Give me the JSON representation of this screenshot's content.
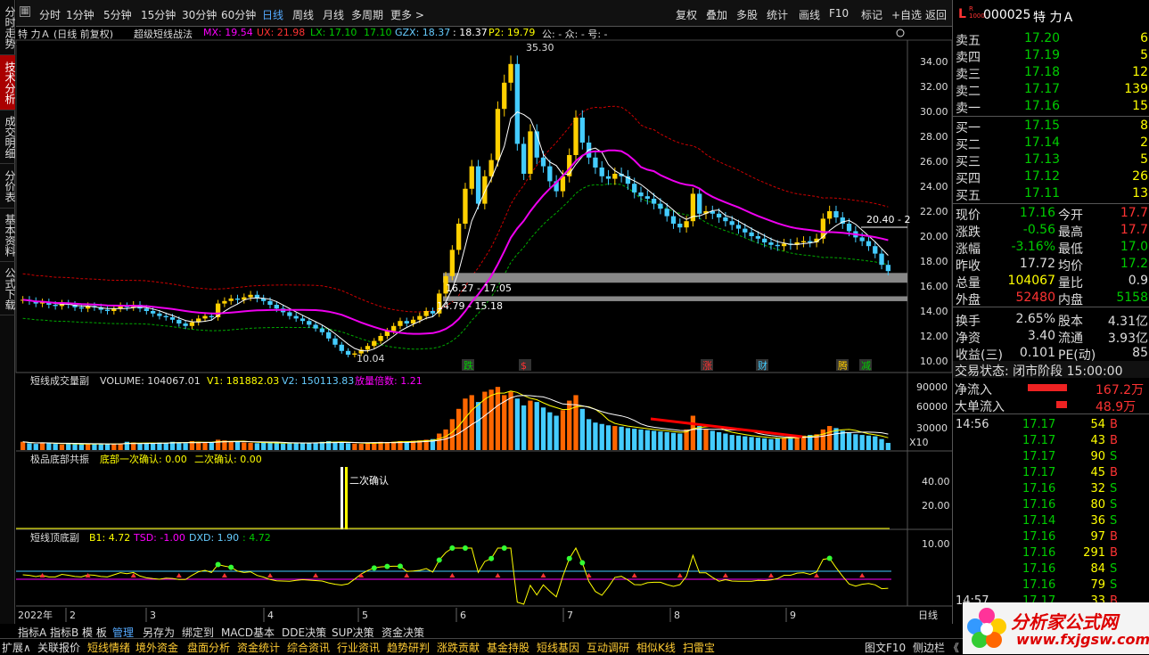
{
  "vtabs": [
    "分时走势",
    "技术分析",
    "成交明细",
    "分价表",
    "基本资料",
    "公式下载"
  ],
  "toolbar": {
    "periods": [
      "分时",
      "1分钟",
      "5分钟",
      "15分钟",
      "30分钟",
      "60分钟",
      "日线",
      "周线",
      "月线",
      "多周期",
      "更多 >"
    ],
    "right_buttons": [
      "复权",
      "叠加",
      "多股",
      "统计",
      "画线",
      "F10",
      "标记",
      "+自选",
      "返回"
    ]
  },
  "title": {
    "stock": "特 力Ａ (日线 前复权)",
    "indicator": "超级短线战法",
    "items": [
      "MX: 19.54",
      "UX: 21.98",
      "LX: 17.10",
      "17.10",
      "GZX: 18.37",
      ": 18.37",
      "P2: 19.79",
      "公: -  众: -  号: -"
    ]
  },
  "main_axis": [
    "34.00",
    "32.00",
    "30.00",
    "28.00",
    "26.00",
    "24.00",
    "22.00",
    "20.00",
    "18.00",
    "16.00",
    "14.00",
    "12.00",
    "10.00"
  ],
  "annotations": {
    "high": "35.30",
    "low": "10.04",
    "zone1": "16.27 - 17.05",
    "zone2": "14.79 - 15.18",
    "right_tag": "20.40 - 2"
  },
  "signals": [
    "跌",
    "$",
    "涨",
    "财",
    "腾",
    "减"
  ],
  "volume_panel": {
    "title": "短线成交量副",
    "volume": "VOLUME: 104067.01",
    "v1": "V1: 181882.03",
    "v2": "V2: 150113.83",
    "ratio": "放量倍数: 1.21",
    "axis": [
      "90000",
      "60000",
      "30000"
    ],
    "unit": "X10"
  },
  "bottom_panel": {
    "title": "极品底部共振",
    "first": "底部一次确认: 0.00",
    "second": "二次确认: 0.00",
    "axis": [
      "40.00",
      "20.00"
    ],
    "label": "二次确认"
  },
  "top_panel": {
    "title": "短线顶底副",
    "b1": "B1: 4.72",
    "tsd": "TSD: -1.00",
    "dxd": "DXD: 1.90",
    "last": ": 4.72",
    "axis": [
      "10.00"
    ]
  },
  "x_axis": {
    "year": "2022年",
    "months": [
      "2",
      "3",
      "4",
      "5",
      "6",
      "7",
      "8",
      "9"
    ],
    "period": "日线"
  },
  "tabs_bottom": [
    "指标A",
    "指标B",
    "模 板",
    "管理",
    "另存为",
    "绑定到",
    "MACD基本",
    "DDE决策",
    "SUP决策",
    "资金决策"
  ],
  "bottom_menu": [
    "扩展∧",
    "关联报价",
    "短线情绪",
    "境外资金",
    "盘面分析",
    "资金统计",
    "综合资讯",
    "行业资讯",
    "趋势研判",
    "涨跌贡献",
    "基金持股",
    "短线基因",
    "互动调研",
    "相似K线",
    "扫雷宝",
    "图文F10",
    "侧边栏 《"
  ],
  "quote": {
    "code": "000025",
    "name": "特 力Ａ",
    "asks": [
      {
        "label": "卖五",
        "price": "17.20",
        "vol": "6"
      },
      {
        "label": "卖四",
        "price": "17.19",
        "vol": "5"
      },
      {
        "label": "卖三",
        "price": "17.18",
        "vol": "12"
      },
      {
        "label": "卖二",
        "price": "17.17",
        "vol": "139"
      },
      {
        "label": "卖一",
        "price": "17.16",
        "vol": "15"
      }
    ],
    "bids": [
      {
        "label": "买一",
        "price": "17.15",
        "vol": "8"
      },
      {
        "label": "买二",
        "price": "17.14",
        "vol": "2"
      },
      {
        "label": "买三",
        "price": "17.13",
        "vol": "5"
      },
      {
        "label": "买四",
        "price": "17.12",
        "vol": "26"
      },
      {
        "label": "买五",
        "price": "17.11",
        "vol": "13"
      }
    ],
    "stats": [
      {
        "l1": "现价",
        "v1": "17.16",
        "l2": "今开",
        "v2": "17.7"
      },
      {
        "l1": "涨跌",
        "v1": "-0.56",
        "l2": "最高",
        "v2": "17.7"
      },
      {
        "l1": "涨幅",
        "v1": "-3.16%",
        "l2": "最低",
        "v2": "17.0"
      },
      {
        "l1": "昨收",
        "v1": "17.72",
        "l2": "均价",
        "v2": "17.2"
      },
      {
        "l1": "总量",
        "v1": "104067",
        "l2": "量比",
        "v2": "0.9"
      },
      {
        "l1": "外盘",
        "v1": "52480",
        "l2": "内盘",
        "v2": "5158"
      },
      {
        "l1": "换手",
        "v1": "2.65%",
        "l2": "股本",
        "v2": "4.31亿"
      },
      {
        "l1": "净资",
        "v1": "3.40",
        "l2": "流通",
        "v2": "3.93亿"
      },
      {
        "l1": "收益(三)",
        "v1": "0.101",
        "l2": "PE(动)",
        "v2": "85"
      }
    ],
    "trade_status": "交易状态: 闭市阶段 15:00:00",
    "net_inflow": {
      "label": "净流入",
      "value": "167.2万"
    },
    "big_inflow": {
      "label": "大单流入",
      "value": "48.9万"
    },
    "ticks": [
      {
        "time": "14:56",
        "price": "17.17",
        "vol": "54",
        "side": "B"
      },
      {
        "time": "",
        "price": "17.17",
        "vol": "43",
        "side": "B"
      },
      {
        "time": "",
        "price": "17.17",
        "vol": "90",
        "side": "S"
      },
      {
        "time": "",
        "price": "17.17",
        "vol": "45",
        "side": "B"
      },
      {
        "time": "",
        "price": "17.16",
        "vol": "32",
        "side": "S"
      },
      {
        "time": "",
        "price": "17.16",
        "vol": "80",
        "side": "S"
      },
      {
        "time": "",
        "price": "17.14",
        "vol": "36",
        "side": "S"
      },
      {
        "time": "",
        "price": "17.16",
        "vol": "97",
        "side": "B"
      },
      {
        "time": "",
        "price": "17.16",
        "vol": "291",
        "side": "B"
      },
      {
        "time": "",
        "price": "17.16",
        "vol": "84",
        "side": "S"
      },
      {
        "time": "",
        "price": "17.16",
        "vol": "79",
        "side": "S"
      },
      {
        "time": "14:57",
        "price": "17.17",
        "vol": "33",
        "side": "B"
      }
    ]
  },
  "logo": {
    "text": "分析家公式网",
    "url": "www.fxjgsw.com"
  },
  "chart_data": {
    "type": "candlestick",
    "price_range": [
      10,
      35.5
    ],
    "closes": [
      14.9,
      14.8,
      14.6,
      14.7,
      14.5,
      14.4,
      14.6,
      14.5,
      14.3,
      14.2,
      14.4,
      14.3,
      14.1,
      14.0,
      14.2,
      14.4,
      14.3,
      14.5,
      14.2,
      14.0,
      13.8,
      13.6,
      13.5,
      13.3,
      13.0,
      12.8,
      13.1,
      13.4,
      13.6,
      13.5,
      14.6,
      14.8,
      15.0,
      14.9,
      15.1,
      15.3,
      15.0,
      14.8,
      14.5,
      14.2,
      13.9,
      13.6,
      13.4,
      13.2,
      12.9,
      12.6,
      12.3,
      11.8,
      11.3,
      10.8,
      10.5,
      10.6,
      10.9,
      11.2,
      11.6,
      12.0,
      12.4,
      12.8,
      13.2,
      13.0,
      13.3,
      13.6,
      14.0,
      13.8,
      15.4,
      16.8,
      18.9,
      21.0,
      23.8,
      25.6,
      22.6,
      24.8,
      26.1,
      30.2,
      32.3,
      33.8,
      27.4,
      25.0,
      28.4,
      26.3,
      25.6,
      24.4,
      23.6,
      24.8,
      26.5,
      29.5,
      27.5,
      26.3,
      25.5,
      24.8,
      24.6,
      25.0,
      24.8,
      24.2,
      23.5,
      23.2,
      23.0,
      22.6,
      22.2,
      21.6,
      21.0,
      20.7,
      21.2,
      23.4,
      21.8,
      22.0,
      21.8,
      21.5,
      21.2,
      20.9,
      20.6,
      20.3,
      20.0,
      19.8,
      19.5,
      19.3,
      19.2,
      19.4,
      19.3,
      19.5,
      19.6,
      19.5,
      19.8,
      21.4,
      22.0,
      21.5,
      21.0,
      20.4,
      19.9,
      19.6,
      19.2,
      18.6,
      17.7,
      17.2
    ],
    "ma_main": {
      "name": "MX",
      "last": 19.54
    },
    "upper": {
      "name": "UX",
      "last": 21.98
    },
    "lower": {
      "name": "LX",
      "last": 17.1
    },
    "volume_range": [
      0,
      100000
    ],
    "volumes": [
      12000,
      10000,
      9000,
      11000,
      10000,
      9000,
      8000,
      9500,
      9000,
      8800,
      9000,
      8500,
      8800,
      9200,
      9000,
      9500,
      12000,
      11000,
      9000,
      9500,
      10000,
      11000,
      10500,
      12000,
      11000,
      10000,
      13000,
      12000,
      11000,
      10500,
      15000,
      14000,
      13000,
      12000,
      11000,
      10500,
      10000,
      11000,
      10500,
      10000,
      9500,
      10000,
      11000,
      10500,
      10000,
      11000,
      12000,
      13000,
      12000,
      11000,
      10000,
      9500,
      9000,
      10000,
      11000,
      12000,
      11500,
      12000,
      13000,
      12500,
      13500,
      14000,
      15000,
      16000,
      24000,
      30000,
      45000,
      60000,
      75000,
      80000,
      70000,
      85000,
      88000,
      92000,
      80000,
      85000,
      75000,
      65000,
      72000,
      70000,
      62000,
      55000,
      50000,
      58000,
      72000,
      80000,
      60000,
      45000,
      40000,
      38000,
      36000,
      35000,
      34000,
      32000,
      31000,
      30000,
      29000,
      28000,
      27000,
      26000,
      25000,
      24000,
      30000,
      50000,
      35000,
      30000,
      28000,
      26000,
      24000,
      22000,
      21000,
      20000,
      19000,
      18000,
      17000,
      16000,
      17000,
      18000,
      19000,
      20000,
      21000,
      22000,
      23000,
      30000,
      35000,
      32000,
      28000,
      25000,
      23000,
      22000,
      21000,
      20000,
      16000,
      10406
    ]
  }
}
